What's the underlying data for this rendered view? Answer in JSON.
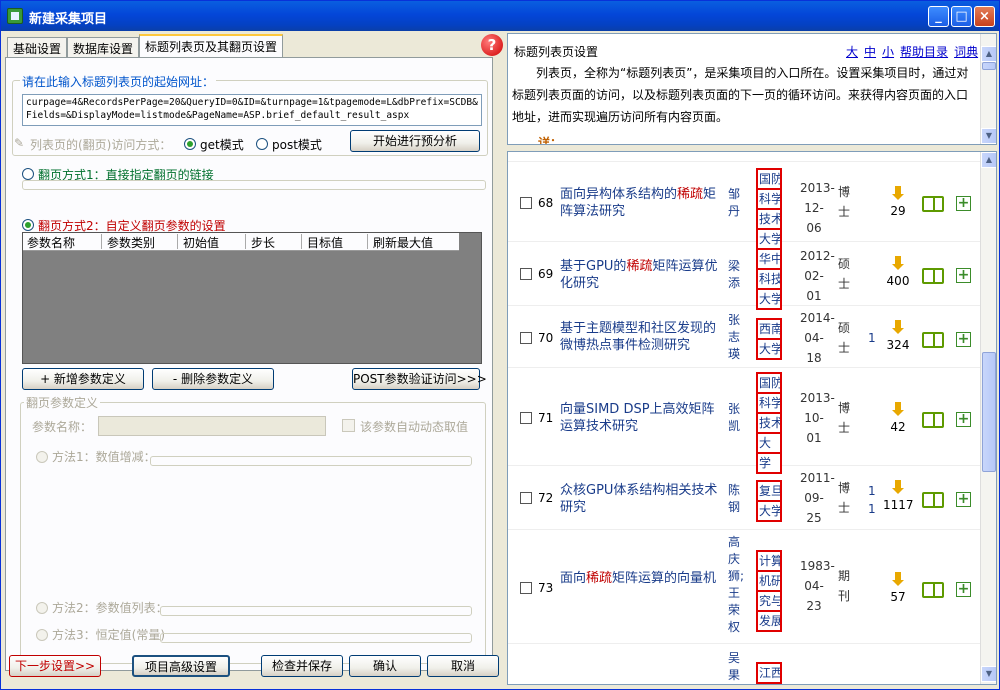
{
  "window": {
    "title": "新建采集项目"
  },
  "tabs": [
    "基础设置",
    "数据库设置",
    "标题列表页及其翻页设置"
  ],
  "url_section": {
    "title": "请在此输入标题列表页的起始网址：",
    "value": "curpage=4&RecordsPerPage=20&QueryID=0&ID=&turnpage=1&tpagemode=L&dbPrefix=SCDB&Fields=&DisplayMode=listmode&PageName=ASP.brief_default_result_aspx"
  },
  "access_mode": {
    "label": "列表页的(翻页)访问方式：",
    "get": "get模式",
    "post": "post模式",
    "analyze_button": "开始进行预分析"
  },
  "paging1": {
    "label": "翻页方式1：直接指定翻页的链接"
  },
  "paging2": {
    "label": "翻页方式2：自定义翻页参数的设置",
    "columns": [
      "参数名称",
      "参数类别",
      "初始值",
      "步长",
      "目标值",
      "刷新最大值"
    ],
    "add_button": "+ 新增参数定义",
    "delete_button": "- 删除参数定义",
    "post_button": "POST参数验证访问>>>"
  },
  "param_def": {
    "title": "翻页参数定义",
    "name_label": "参数名称：",
    "auto_label": "该参数自动动态取值",
    "method1": "方法1：数值增减：",
    "method2": "方法2：参数值列表：",
    "method3": "方法3：恒定值(常量)"
  },
  "footer": {
    "next": "下一步设置>>",
    "advanced": "项目高级设置",
    "check_save": "检查并保存",
    "ok": "确认",
    "cancel": "取消"
  },
  "help": {
    "title": "标题列表页设置",
    "links": [
      "大",
      "中",
      "小",
      "帮助目录",
      "词典"
    ],
    "text": "列表页，全称为“标题列表页”，是采集项目的入口所在。设置采集项目时，通过对标题列表页面的访问，以及标题列表页面的下一页的循环访问。来获得内容页面的入口地址，进而实现遍历访问所有内容页面。",
    "detail": "详："
  },
  "results": [
    {
      "num": "68",
      "title_pre": "面向异构体系结构的",
      "hl": "稀疏",
      "title_post": "矩阵算法研究",
      "author": "邹丹",
      "inst": [
        "国防",
        "科学",
        "技术",
        "大学"
      ],
      "date": "2013-12-06",
      "type": "博士",
      "cite": "",
      "downloads": "29"
    },
    {
      "num": "69",
      "title_pre": "基于GPU的",
      "hl": "稀疏",
      "title_post": "矩阵运算优化研究",
      "author": "梁添",
      "inst": [
        "华中",
        "科技",
        "大学"
      ],
      "date": "2012-02-01",
      "type": "硕士",
      "cite": "",
      "downloads": "400"
    },
    {
      "num": "70",
      "title_pre": "基于主题模型和社区发现的微博热点事件检测研究",
      "hl": "",
      "title_post": "",
      "author": "张志瑛",
      "inst": [
        "西南",
        "大学"
      ],
      "date": "2014-04-18",
      "type": "硕士",
      "cite": "1",
      "downloads": "324"
    },
    {
      "num": "71",
      "title_pre": "向量SIMD DSP上高效矩阵运算技术研究",
      "hl": "",
      "title_post": "",
      "author": "张凯",
      "inst": [
        "国防",
        "科学",
        "技术",
        "大",
        "学"
      ],
      "date": "2013-10-01",
      "type": "博士",
      "cite": "",
      "downloads": "42"
    },
    {
      "num": "72",
      "title_pre": "众核GPU体系结构相关技术研究",
      "hl": "",
      "title_post": "",
      "author": "陈钢",
      "inst": [
        "复旦",
        "大学"
      ],
      "date": "2011-09-25",
      "type": "博士",
      "cite": "11",
      "downloads": "1117"
    },
    {
      "num": "73",
      "title_pre": "面向",
      "hl": "稀疏",
      "title_post": "矩阵运算的向量机",
      "author": "高庆狮;王荣权",
      "inst": [
        "计算",
        "机研",
        "究与",
        "发展"
      ],
      "date": "1983-04-23",
      "type": "期刊",
      "cite": "",
      "downloads": "57"
    },
    {
      "num": "",
      "title_pre": "",
      "hl": "",
      "title_post": "",
      "author": "吴果",
      "inst": [
        "江西"
      ],
      "date": "",
      "type": "",
      "cite": "",
      "downloads": ""
    }
  ],
  "colors": {
    "title_bar": "#0446d8",
    "accent_red": "#c00000",
    "link_blue": "#0000cc",
    "chrome": "#ece9d8"
  }
}
